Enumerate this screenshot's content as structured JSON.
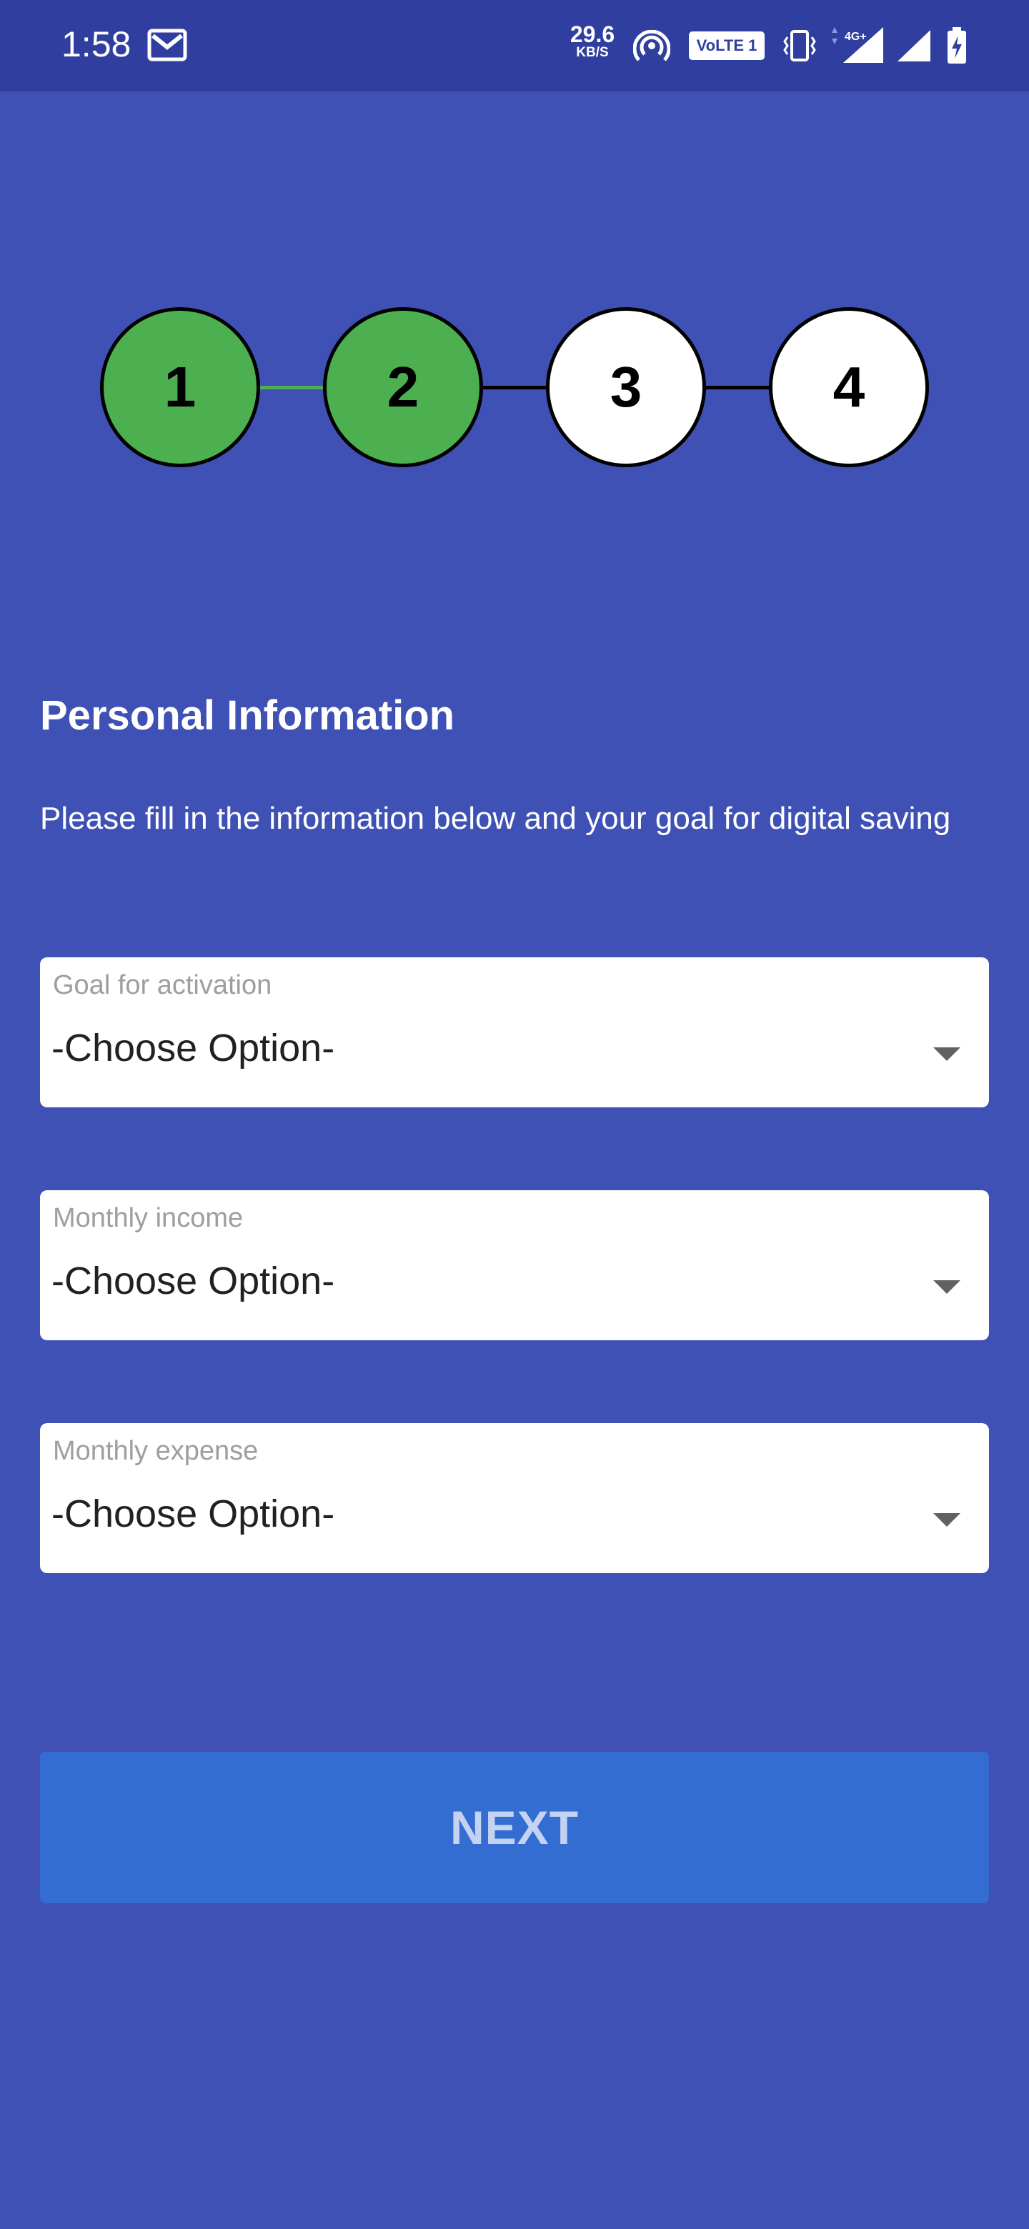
{
  "status_bar": {
    "time": "1:58",
    "net_speed_value": "29.6",
    "net_speed_unit": "KB/S",
    "volte_label": "VoLTE 1",
    "network_type": "4G+"
  },
  "stepper": {
    "steps": [
      {
        "label": "1",
        "state": "done"
      },
      {
        "label": "2",
        "state": "done"
      },
      {
        "label": "3",
        "state": "pending"
      },
      {
        "label": "4",
        "state": "pending"
      }
    ],
    "colors": {
      "done": "#4caf50",
      "pending": "#ffffff"
    }
  },
  "form": {
    "title": "Personal Information",
    "description": "Please fill in the information below and your goal for digital saving",
    "fields": [
      {
        "label": "Goal for activation",
        "value": "-Choose Option-"
      },
      {
        "label": "Monthly income",
        "value": "-Choose Option-"
      },
      {
        "label": "Monthly expense",
        "value": "-Choose Option-"
      }
    ],
    "next_label": "NEXT"
  },
  "colors": {
    "background": "#3f51b5",
    "status_bar": "#303f9f",
    "button": "#346dd1"
  }
}
